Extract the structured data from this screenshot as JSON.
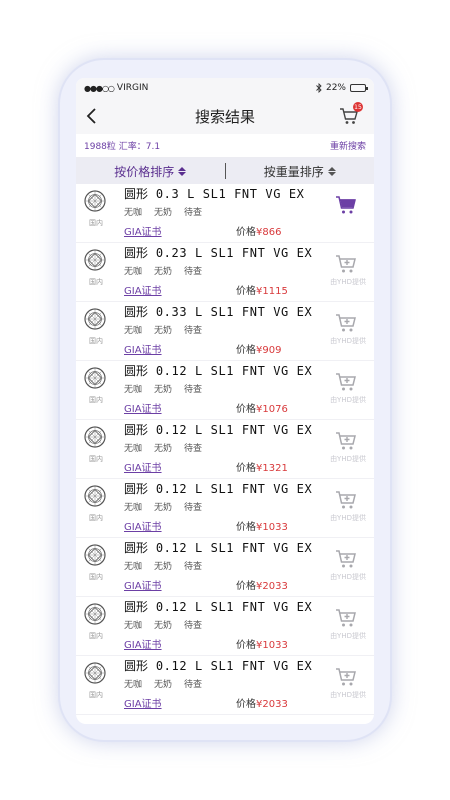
{
  "status": {
    "carrier": "VIRGIN",
    "signal_dots": "●●●○○",
    "battery": "22%",
    "battery_level": 0.22
  },
  "nav": {
    "title": "搜索结果",
    "cart_badge": "15"
  },
  "info": {
    "summary": "1988粒 汇率：7.1",
    "research": "重新搜索"
  },
  "sort": {
    "by_price": "按价格排序",
    "by_weight": "按重量排序"
  },
  "items": [
    {
      "shape": "圆形",
      "specs": "0.3 L SL1 FNT VG EX",
      "tags": [
        "无咖",
        "无奶",
        "待查"
      ],
      "origin": "国内",
      "cert": "GIA证书",
      "price_label": "价格",
      "price": "¥866",
      "vendor": "",
      "cart_active": true
    },
    {
      "shape": "圆形",
      "specs": "0.23 L SL1 FNT VG EX",
      "tags": [
        "无咖",
        "无奶",
        "待查"
      ],
      "origin": "国内",
      "cert": "GIA证书",
      "price_label": "价格",
      "price": "¥1115",
      "vendor": "由YHD提供",
      "cart_active": false
    },
    {
      "shape": "圆形",
      "specs": "0.33 L SL1 FNT VG EX",
      "tags": [
        "无咖",
        "无奶",
        "待查"
      ],
      "origin": "国内",
      "cert": "GIA证书",
      "price_label": "价格",
      "price": "¥909",
      "vendor": "由YHD提供",
      "cart_active": false
    },
    {
      "shape": "圆形",
      "specs": "0.12 L SL1 FNT VG EX",
      "tags": [
        "无咖",
        "无奶",
        "待查"
      ],
      "origin": "国内",
      "cert": "GIA证书",
      "price_label": "价格",
      "price": "¥1076",
      "vendor": "由YHD提供",
      "cart_active": false
    },
    {
      "shape": "圆形",
      "specs": "0.12 L SL1 FNT VG EX",
      "tags": [
        "无咖",
        "无奶",
        "待查"
      ],
      "origin": "国内",
      "cert": "GIA证书",
      "price_label": "价格",
      "price": "¥1321",
      "vendor": "由YHD提供",
      "cart_active": false
    },
    {
      "shape": "圆形",
      "specs": "0.12 L SL1 FNT VG EX",
      "tags": [
        "无咖",
        "无奶",
        "待查"
      ],
      "origin": "国内",
      "cert": "GIA证书",
      "price_label": "价格",
      "price": "¥1033",
      "vendor": "由YHD提供",
      "cart_active": false
    },
    {
      "shape": "圆形",
      "specs": "0.12 L SL1 FNT VG EX",
      "tags": [
        "无咖",
        "无奶",
        "待查"
      ],
      "origin": "国内",
      "cert": "GIA证书",
      "price_label": "价格",
      "price": "¥2033",
      "vendor": "由YHD提供",
      "cart_active": false
    },
    {
      "shape": "圆形",
      "specs": "0.12 L SL1 FNT VG EX",
      "tags": [
        "无咖",
        "无奶",
        "待查"
      ],
      "origin": "国内",
      "cert": "GIA证书",
      "price_label": "价格",
      "price": "¥1033",
      "vendor": "由YHD提供",
      "cart_active": false
    },
    {
      "shape": "圆形",
      "specs": "0.12 L SL1 FNT VG EX",
      "tags": [
        "无咖",
        "无奶",
        "待查"
      ],
      "origin": "国内",
      "cert": "GIA证书",
      "price_label": "价格",
      "price": "¥2033",
      "vendor": "由YHD提供",
      "cart_active": false
    }
  ],
  "colors": {
    "accent": "#6c3fa5",
    "price": "#d8393b",
    "cart_inactive": "#a8a8ad"
  },
  "icons": {
    "back": "chevron-left-icon",
    "cart": "shopping-cart-icon",
    "gem": "diamond-icon",
    "add_cart": "add-to-cart-icon",
    "sort": "sort-arrows-icon"
  }
}
